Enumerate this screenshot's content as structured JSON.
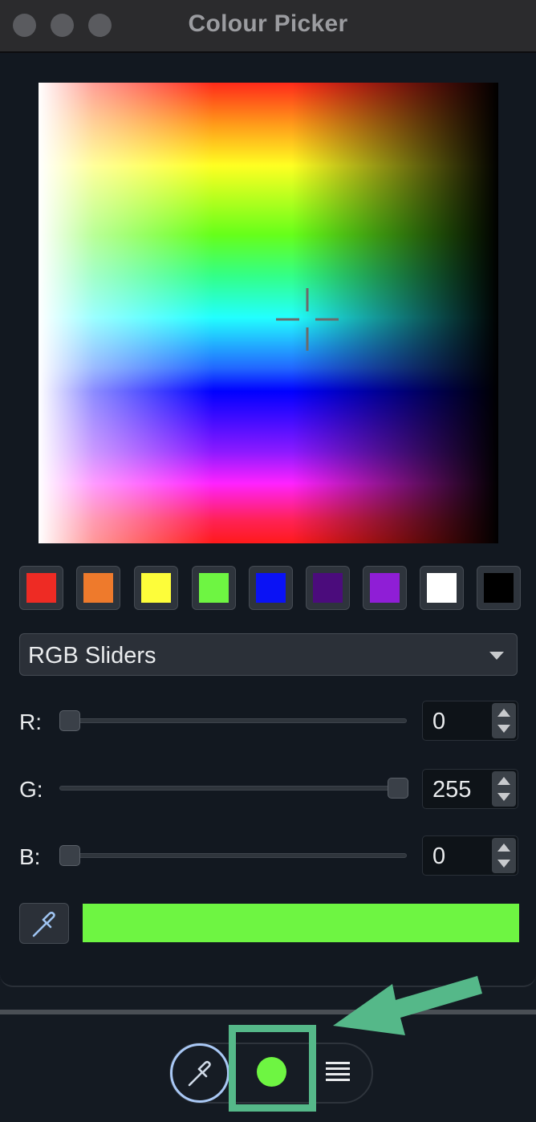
{
  "window": {
    "title": "Colour Picker"
  },
  "swatches": [
    {
      "name": "red",
      "color": "#ee2b24"
    },
    {
      "name": "orange",
      "color": "#ee7a2c"
    },
    {
      "name": "yellow",
      "color": "#fdfd3a"
    },
    {
      "name": "green",
      "color": "#6ef542"
    },
    {
      "name": "blue",
      "color": "#0a12f5"
    },
    {
      "name": "dark-purple",
      "color": "#4b0c7c"
    },
    {
      "name": "purple",
      "color": "#8f1ed6"
    },
    {
      "name": "white",
      "color": "#ffffff"
    },
    {
      "name": "black",
      "color": "#000000"
    }
  ],
  "mode_dropdown": {
    "selected": "RGB Sliders"
  },
  "sliders": [
    {
      "label": "R:",
      "value": "0",
      "fraction": 0.0
    },
    {
      "label": "G:",
      "value": "255",
      "fraction": 1.0
    },
    {
      "label": "B:",
      "value": "0",
      "fraction": 0.0
    }
  ],
  "current_color": "#6ef542",
  "icons": {
    "eyedropper": "eyedropper-icon",
    "list": "list-icon",
    "crosshair": "crosshair-icon"
  }
}
